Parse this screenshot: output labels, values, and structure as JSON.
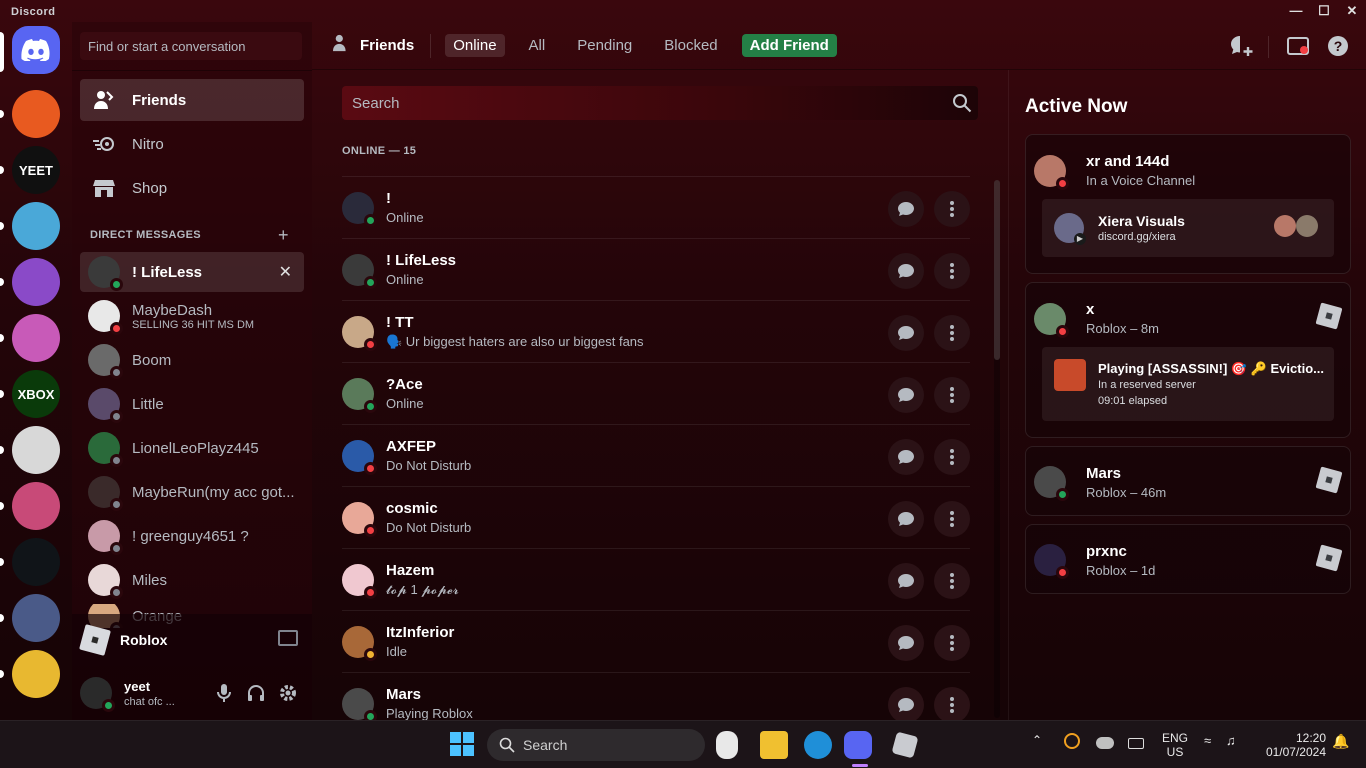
{
  "window": {
    "title": "Discord"
  },
  "dm_column": {
    "find_placeholder": "Find or start a conversation",
    "nav": [
      {
        "label": "Friends"
      },
      {
        "label": "Nitro"
      },
      {
        "label": "Shop"
      }
    ],
    "dm_header": "DIRECT MESSAGES",
    "dms": [
      {
        "name": "! LifeLess",
        "sub": "",
        "status": "online",
        "color": "#3a3a3a"
      },
      {
        "name": "MaybeDash",
        "sub": "SELLING 36 HIT MS DM",
        "status": "dnd",
        "color": "#e8e8e8"
      },
      {
        "name": "Boom",
        "sub": "",
        "status": "offline",
        "color": "#6a6a6a"
      },
      {
        "name": "Little",
        "sub": "",
        "status": "offline",
        "color": "#5a4a6a"
      },
      {
        "name": "LionelLeoPlayz445",
        "sub": "",
        "status": "offline",
        "color": "#2a6a3a"
      },
      {
        "name": "MaybeRun(my acc got...",
        "sub": "",
        "status": "offline",
        "color": "#3a2a2a"
      },
      {
        "name": "! greenguy4651 ?",
        "sub": "",
        "status": "offline",
        "color": "#c89aa8"
      },
      {
        "name": "Miles",
        "sub": "",
        "status": "offline",
        "color": "#e8d8d8"
      },
      {
        "name": "Orange",
        "sub": "",
        "status": "offline",
        "color": "#d8a880"
      }
    ],
    "activity": {
      "label": "Roblox"
    },
    "user": {
      "name": "yeet",
      "status": "chat ofc ..."
    }
  },
  "tabs": {
    "title": "Friends",
    "items": [
      "Online",
      "All",
      "Pending",
      "Blocked"
    ],
    "add": "Add Friend"
  },
  "search": {
    "placeholder": "Search"
  },
  "online_header": "ONLINE — 15",
  "friends": [
    {
      "name": "!",
      "status_text": "Online",
      "status": "online",
      "color": "#2a2a3a"
    },
    {
      "name": "! LifeLess",
      "status_text": "Online",
      "status": "online",
      "color": "#3a3a3a"
    },
    {
      "name": "! TT",
      "status_text": "🗣️ Ur biggest haters are also ur biggest fans",
      "status": "dnd",
      "color": "#c8a888"
    },
    {
      "name": "?Ace",
      "status_text": "Online",
      "status": "online",
      "color": "#5a7a5a"
    },
    {
      "name": "AXFEP",
      "status_text": "Do Not Disturb",
      "status": "dnd",
      "color": "#2a5aa8"
    },
    {
      "name": "cosmic",
      "status_text": "Do Not Disturb",
      "status": "dnd",
      "color": "#e8a898"
    },
    {
      "name": "Hazem",
      "status_text": "𝓽𝓸𝓹 1 𝓹𝓸𝓹𝓮𝓻",
      "status": "dnd",
      "color": "#f0c8d0"
    },
    {
      "name": "ItzInferior",
      "status_text": "Idle",
      "status": "idle",
      "color": "#a86838"
    },
    {
      "name": "Mars",
      "status_text": "Playing Roblox",
      "status": "online",
      "color": "#4a4a4a"
    }
  ],
  "active_now": {
    "title": "Active Now",
    "cards": [
      {
        "name": "xr and 144d",
        "sub": "In a Voice Channel",
        "status": "dnd",
        "color": "#b87868",
        "inner_title": "Xiera Visuals",
        "inner_sub": "discord.gg/xiera"
      },
      {
        "name": "x",
        "sub": "Roblox – 8m",
        "status": "dnd",
        "color": "#6a8a6a",
        "inner_title": "Playing [ASSASSIN!] 🎯 🔑 Evictio...",
        "inner_sub": "In a reserved server",
        "inner_sub2": "09:01 elapsed"
      },
      {
        "name": "Mars",
        "sub": "Roblox – 46m",
        "status": "online",
        "color": "#4a4a4a"
      },
      {
        "name": "prxnc",
        "sub": "Roblox – 1d",
        "status": "dnd",
        "color": "#2a2040"
      }
    ]
  },
  "taskbar": {
    "search": "Search",
    "lang1": "ENG",
    "lang2": "US",
    "time": "12:20",
    "date": "01/07/2024"
  },
  "servers": [
    {
      "color": "#e85a20",
      "text": ""
    },
    {
      "color": "#101010",
      "text": "YEET"
    },
    {
      "color": "#4aa8d8",
      "text": ""
    },
    {
      "color": "#8a4ac8",
      "text": ""
    },
    {
      "color": "#c85ab8",
      "text": ""
    },
    {
      "color": "#0a3a0a",
      "text": "XBOX"
    },
    {
      "color": "#d8d8d8",
      "text": ""
    },
    {
      "color": "#c84a78",
      "text": ""
    },
    {
      "color": "#101418",
      "text": ""
    },
    {
      "color": "#4a5a88",
      "text": ""
    },
    {
      "color": "#e8b830",
      "text": ""
    }
  ]
}
